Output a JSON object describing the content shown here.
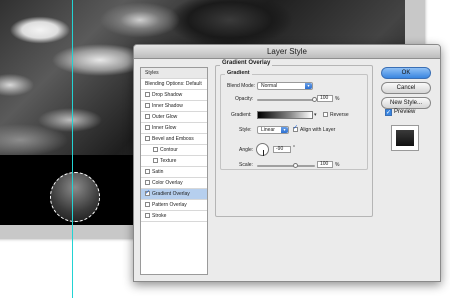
{
  "dialog": {
    "title": "Layer Style"
  },
  "styles_panel": {
    "header": "Styles",
    "blending_options": "Blending Options: Default",
    "items": [
      {
        "label": "Drop Shadow",
        "checked": false,
        "selected": false
      },
      {
        "label": "Inner Shadow",
        "checked": false,
        "selected": false
      },
      {
        "label": "Outer Glow",
        "checked": false,
        "selected": false
      },
      {
        "label": "Inner Glow",
        "checked": false,
        "selected": false
      },
      {
        "label": "Bevel and Emboss",
        "checked": false,
        "selected": false
      },
      {
        "label": "Contour",
        "checked": false,
        "selected": false,
        "indent": true
      },
      {
        "label": "Texture",
        "checked": false,
        "selected": false,
        "indent": true
      },
      {
        "label": "Satin",
        "checked": false,
        "selected": false
      },
      {
        "label": "Color Overlay",
        "checked": false,
        "selected": false
      },
      {
        "label": "Gradient Overlay",
        "checked": true,
        "selected": true
      },
      {
        "label": "Pattern Overlay",
        "checked": false,
        "selected": false
      },
      {
        "label": "Stroke",
        "checked": false,
        "selected": false
      }
    ]
  },
  "gradient_overlay": {
    "section_title": "Gradient Overlay",
    "group_title": "Gradient",
    "blend_mode_label": "Blend Mode:",
    "blend_mode_value": "Normal",
    "opacity_label": "Opacity:",
    "opacity_value": "100",
    "opacity_unit": "%",
    "opacity_fraction": 1.0,
    "gradient_label": "Gradient:",
    "reverse_label": "Reverse",
    "reverse_checked": false,
    "style_label": "Style:",
    "style_value": "Linear",
    "align_label": "Align with Layer",
    "align_checked": true,
    "angle_label": "Angle:",
    "angle_value": "-90",
    "angle_unit": "°",
    "scale_label": "Scale:",
    "scale_value": "100",
    "scale_unit": "%",
    "scale_fraction": 0.67
  },
  "buttons": {
    "ok": "OK",
    "cancel": "Cancel",
    "new_style": "New Style...",
    "preview_label": "Preview",
    "preview_checked": true
  },
  "colors": {
    "accent": "#3a86e0",
    "selection": "#b6cfee",
    "guide": "#22d3d3"
  }
}
